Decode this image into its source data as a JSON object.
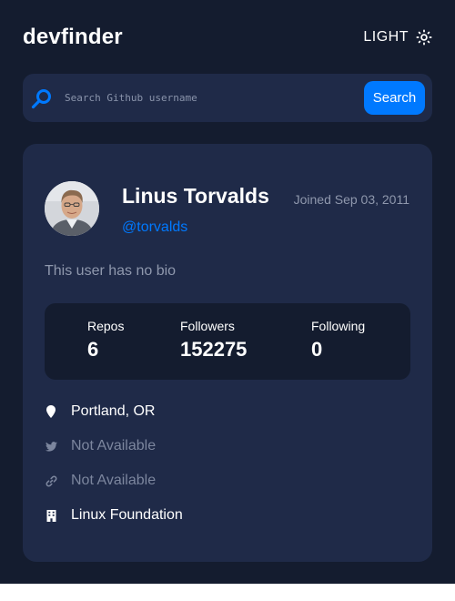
{
  "header": {
    "logo": "devfinder",
    "theme_label": "LIGHT"
  },
  "search": {
    "placeholder": "Search Github username",
    "value": "",
    "button_label": "Search"
  },
  "profile": {
    "name": "Linus Torvalds",
    "joined": "Joined Sep 03, 2011",
    "login": "@torvalds",
    "bio": "This user has no bio",
    "stats": {
      "repos_label": "Repos",
      "repos_value": "6",
      "followers_label": "Followers",
      "followers_value": "152275",
      "following_label": "Following",
      "following_value": "0"
    },
    "links": {
      "location": "Portland, OR",
      "twitter": "Not Available",
      "website": "Not Available",
      "company": "Linux Foundation"
    }
  },
  "icons": {
    "theme": "sun-icon",
    "search": "search-icon",
    "location": "location-pin-icon",
    "twitter": "twitter-icon",
    "website": "link-icon",
    "company": "building-icon"
  },
  "colors": {
    "background": "#141c2f",
    "card": "#1f2a48",
    "accent": "#0079ff",
    "text": "#ffffff",
    "muted": "#8f98ad"
  }
}
